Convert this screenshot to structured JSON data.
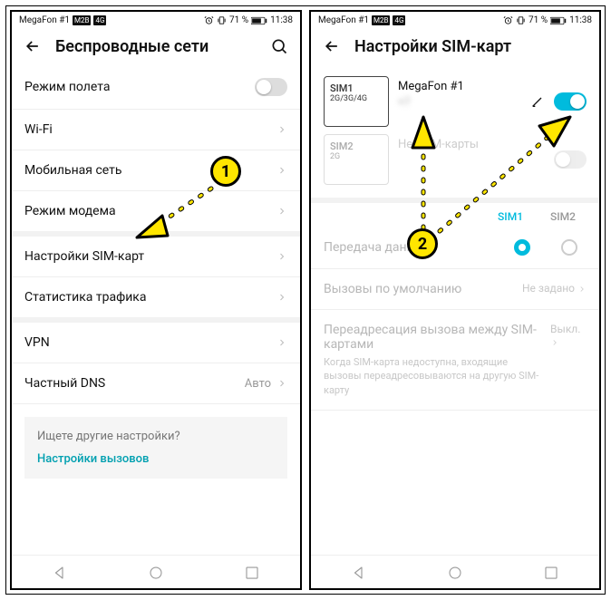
{
  "statusbar": {
    "carrier": "MegaFon #1",
    "badge1": "M2B",
    "badge2": "4G",
    "battery": "71 %",
    "time": "11:38"
  },
  "left": {
    "title": "Беспроводные сети",
    "rows": {
      "airplane": "Режим полета",
      "wifi": "Wi-Fi",
      "mobile": "Мобильная сеть",
      "tether": "Режим модема",
      "sim": "Настройки SIM-карт",
      "traffic": "Статистика трафика",
      "vpn": "VPN",
      "dns": "Частный DNS",
      "dns_val": "Авто"
    },
    "hint_q": "Ищете другие настройки?",
    "hint_link": "Настройки вызовов"
  },
  "right": {
    "title": "Настройки SIM-карт",
    "sim1": {
      "name": "SIM1",
      "mode": "2G/3G/4G",
      "operator": "MegaFon #1",
      "number": "+7"
    },
    "sim2": {
      "name": "SIM2",
      "mode": "2G",
      "operator": "Нет SIM-карты"
    },
    "col1": "SIM1",
    "col2": "SIM2",
    "data_label": "Передача данных",
    "calls_label": "Вызовы по умолчанию",
    "calls_val": "Не задано",
    "fwd_title": "Переадресация вызова между SIM-картами",
    "fwd_desc": "Когда SIM-карта недоступна, входящие вызовы переадресовываются на другую SIM-карту",
    "fwd_val": "Выкл."
  },
  "annot": {
    "n1": "1",
    "n2": "2"
  }
}
